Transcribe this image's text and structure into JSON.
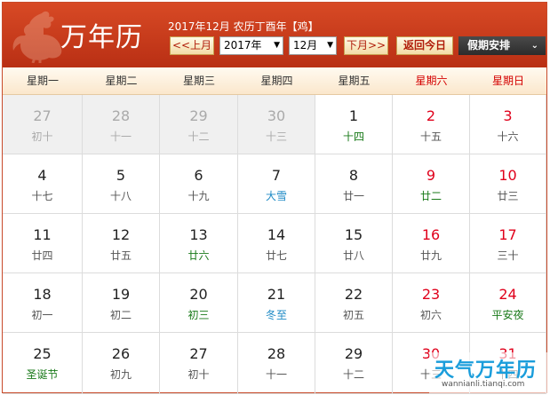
{
  "header": {
    "logo": "万年历",
    "info": "2017年12月 农历丁酉年【鸡】",
    "prev_month": "<<上月",
    "year_select": "2017年",
    "month_select": "12月",
    "next_month": "下月>>",
    "today": "返回今日",
    "holiday": "假期安排"
  },
  "weekdays": [
    "星期一",
    "星期二",
    "星期三",
    "星期四",
    "星期五",
    "星期六",
    "星期日"
  ],
  "weeks": [
    [
      {
        "d": "27",
        "l": "初十",
        "dim": true
      },
      {
        "d": "28",
        "l": "十一",
        "dim": true
      },
      {
        "d": "29",
        "l": "十二",
        "dim": true
      },
      {
        "d": "30",
        "l": "十三",
        "dim": true
      },
      {
        "d": "1",
        "l": "十四",
        "lc": "green"
      },
      {
        "d": "2",
        "l": "十五"
      },
      {
        "d": "3",
        "l": "十六"
      }
    ],
    [
      {
        "d": "4",
        "l": "十七"
      },
      {
        "d": "5",
        "l": "十八"
      },
      {
        "d": "6",
        "l": "十九"
      },
      {
        "d": "7",
        "l": "大雪",
        "lc": "blue"
      },
      {
        "d": "8",
        "l": "廿一"
      },
      {
        "d": "9",
        "l": "廿二",
        "lc": "green"
      },
      {
        "d": "10",
        "l": "廿三"
      }
    ],
    [
      {
        "d": "11",
        "l": "廿四"
      },
      {
        "d": "12",
        "l": "廿五"
      },
      {
        "d": "13",
        "l": "廿六",
        "lc": "green"
      },
      {
        "d": "14",
        "l": "廿七"
      },
      {
        "d": "15",
        "l": "廿八"
      },
      {
        "d": "16",
        "l": "廿九"
      },
      {
        "d": "17",
        "l": "三十"
      }
    ],
    [
      {
        "d": "18",
        "l": "初一"
      },
      {
        "d": "19",
        "l": "初二"
      },
      {
        "d": "20",
        "l": "初三",
        "lc": "green"
      },
      {
        "d": "21",
        "l": "冬至",
        "lc": "blue"
      },
      {
        "d": "22",
        "l": "初五"
      },
      {
        "d": "23",
        "l": "初六"
      },
      {
        "d": "24",
        "l": "平安夜",
        "lc": "green"
      }
    ],
    [
      {
        "d": "25",
        "l": "圣诞节",
        "lc": "green"
      },
      {
        "d": "26",
        "l": "初九"
      },
      {
        "d": "27",
        "l": "初十"
      },
      {
        "d": "28",
        "l": "十一"
      },
      {
        "d": "29",
        "l": "十二"
      },
      {
        "d": "30",
        "l": "十三"
      },
      {
        "d": "31",
        "l": "十四"
      }
    ]
  ],
  "watermark": {
    "main": "天气万年历",
    "sub": "wannianli.tianqi.com"
  },
  "colors": {
    "header_red": "#c8381b",
    "weekend_red": "#e0001b",
    "holiday_green": "#1a7a1a",
    "solar_term_blue": "#1e8ac5"
  },
  "icons": [
    "rooster-icon",
    "dropdown-arrow-icon"
  ]
}
